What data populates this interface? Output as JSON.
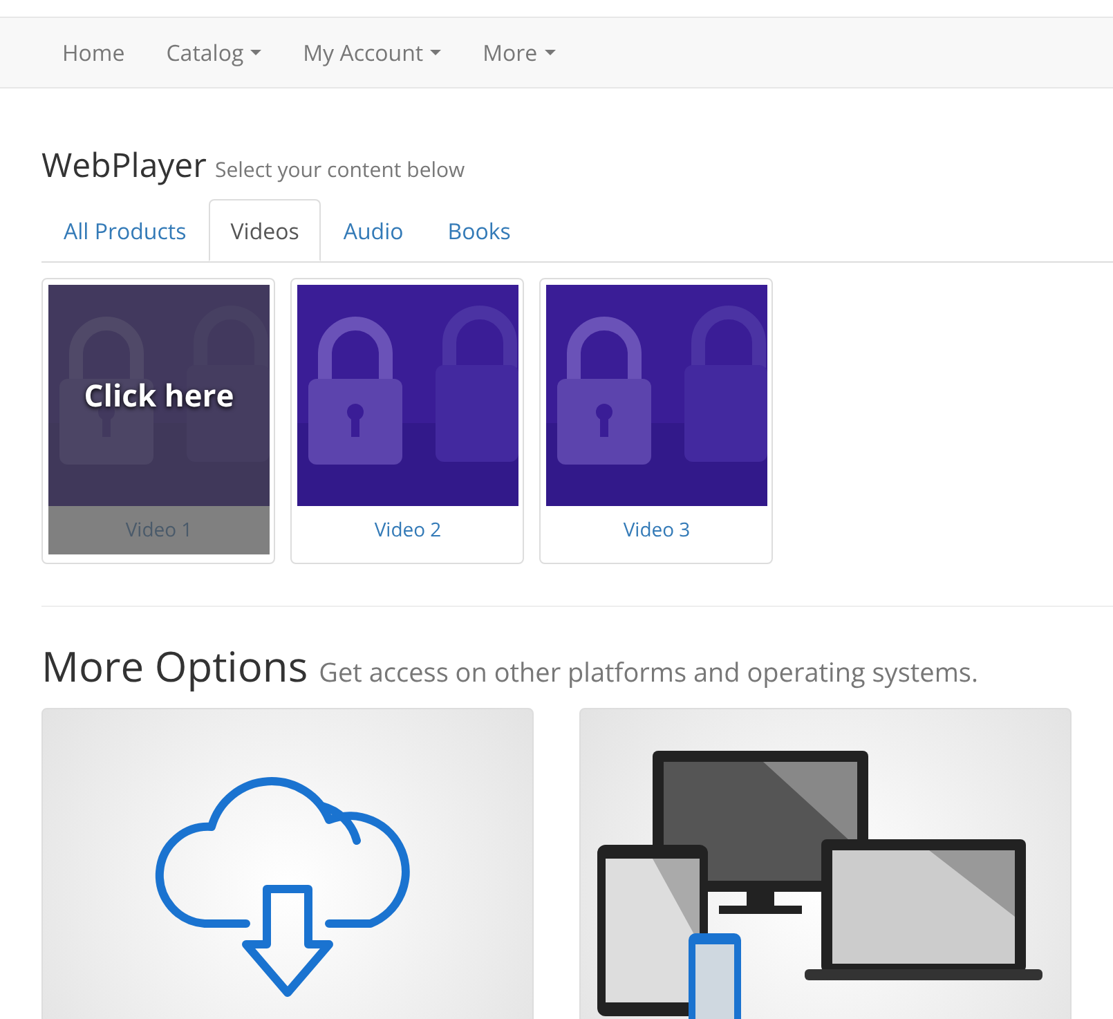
{
  "navbar": {
    "items": [
      {
        "label": "Home",
        "dropdown": false
      },
      {
        "label": "Catalog",
        "dropdown": true
      },
      {
        "label": "My Account",
        "dropdown": true
      },
      {
        "label": "More",
        "dropdown": true
      }
    ]
  },
  "heading": {
    "title": "WebPlayer",
    "subtitle": "Select your content below"
  },
  "tabs": [
    {
      "label": "All Products",
      "selected": false
    },
    {
      "label": "Videos",
      "selected": true
    },
    {
      "label": "Audio",
      "selected": false
    },
    {
      "label": "Books",
      "selected": false
    }
  ],
  "videos": [
    {
      "title": "Video 1",
      "hovered": true,
      "overlay": "Click here"
    },
    {
      "title": "Video 2",
      "hovered": false
    },
    {
      "title": "Video 3",
      "hovered": false
    }
  ],
  "more_options": {
    "title": "More Options",
    "subtitle": "Get access on other platforms and operating systems.",
    "cards": [
      {
        "kind": "download"
      },
      {
        "kind": "devices"
      }
    ]
  }
}
